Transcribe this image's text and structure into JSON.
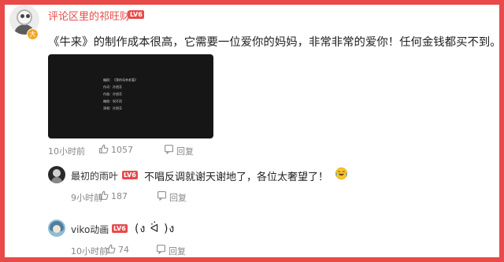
{
  "main_comment": {
    "username": "评论区里的祁旺财",
    "level": "LV6",
    "avatar_badge": "大",
    "text": "《牛来》的制作成本很高，它需要一位爱你的妈妈，非常非常的爱你！任何金钱都买不到。",
    "video": {
      "credits": [
        "编剧：《我的母亲老著》",
        "作词：孙朋芳",
        "作曲：孙朋芳",
        "编曲：祝开凯",
        "演唱：孙朋芳"
      ]
    },
    "time": "10小时前",
    "likes": "1057",
    "reply_label": "回复"
  },
  "replies": [
    {
      "username": "最初的雨叶",
      "level": "LV6",
      "text": "不唱反调就谢天谢地了，各位太奢望了！",
      "emoji": "laugh-cry-emoji",
      "time": "9小时前",
      "likes": "187",
      "reply_label": "回复"
    },
    {
      "username": "viko动画",
      "level": "LV6",
      "text": "(ง ᐛ )ง",
      "time": "10小时前",
      "likes": "74",
      "reply_label": "回复"
    }
  ],
  "colors": {
    "frame_border": "#e84a4a",
    "username_highlight": "#e84a4a",
    "level_badge": "#e84a4a",
    "meta_text": "#888888",
    "video_background": "#161616"
  }
}
